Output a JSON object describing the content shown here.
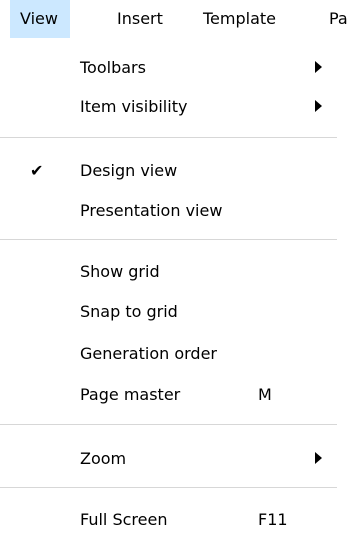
{
  "menubar": {
    "items": [
      {
        "label": "View",
        "active": true
      },
      {
        "label": "Insert"
      },
      {
        "label": "Template"
      },
      {
        "label": "Pa"
      }
    ]
  },
  "menu": {
    "toolbars": {
      "label": "Toolbars",
      "submenu": true
    },
    "item_visibility": {
      "label": "Item visibility",
      "submenu": true
    },
    "design_view": {
      "label": "Design view",
      "checked": true,
      "check_glyph": "✔"
    },
    "presentation_view": {
      "label": "Presentation view"
    },
    "show_grid": {
      "label": "Show grid"
    },
    "snap_to_grid": {
      "label": "Snap to grid"
    },
    "generation_order": {
      "label": "Generation order"
    },
    "page_master": {
      "label": "Page master",
      "shortcut": "M"
    },
    "zoom": {
      "label": "Zoom",
      "submenu": true
    },
    "full_screen": {
      "label": "Full Screen",
      "shortcut": "F11"
    }
  },
  "colors": {
    "menubar_active_bg": "#cce8ff",
    "separator": "#d7d7d7"
  }
}
